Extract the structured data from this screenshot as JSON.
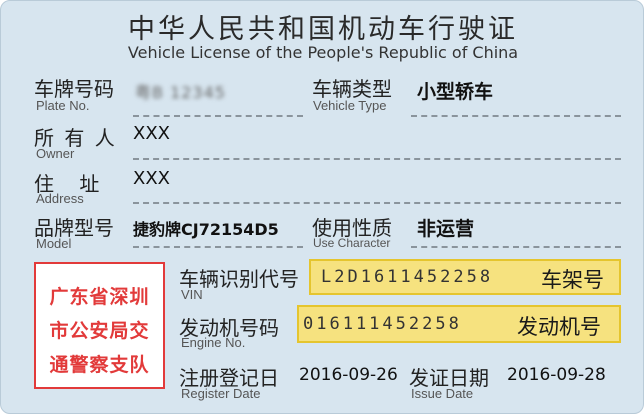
{
  "title": {
    "cn": "中华人民共和国机动车行驶证",
    "en": "Vehicle License of the People's Republic of China"
  },
  "plate": {
    "label_cn": "车牌号码",
    "label_en": "Plate No.",
    "value": "粤B 12345"
  },
  "vehicle_type": {
    "label_cn": "车辆类型",
    "label_en": "Vehicle Type",
    "value": "小型轿车"
  },
  "owner": {
    "label_cn": "所 有 人",
    "label_en": "Owner",
    "value": "XXX"
  },
  "address": {
    "label_cn": "住    址",
    "label_en": "Address",
    "value": "XXX"
  },
  "model": {
    "label_cn": "品牌型号",
    "label_en": "Model",
    "value": "捷豹牌CJ72154D5"
  },
  "use_character": {
    "label_cn": "使用性质",
    "label_en": "Use Character",
    "value": "非运营"
  },
  "stamp": {
    "lines": [
      "广东省深圳",
      "市公安局交",
      "通警察支队"
    ],
    "color": "#e23a3a"
  },
  "vin": {
    "label_cn": "车辆识别代号",
    "label_en": "VIN",
    "value": "L2D1611452258",
    "tag": "车架号"
  },
  "engine": {
    "label_cn": "发动机号码",
    "label_en": "Engine No.",
    "value": "016111452258",
    "tag": "发动机号"
  },
  "register_date": {
    "label_cn": "注册登记日",
    "label_en": "Register Date",
    "value": "2016-09-26"
  },
  "issue_date": {
    "label_cn": "发证日期",
    "label_en": "Issue Date",
    "value": "2016-09-28"
  },
  "colors": {
    "card_bg": "#d7e5ef",
    "highlight": "#f6e27f",
    "highlight_border": "#e5c52e"
  }
}
